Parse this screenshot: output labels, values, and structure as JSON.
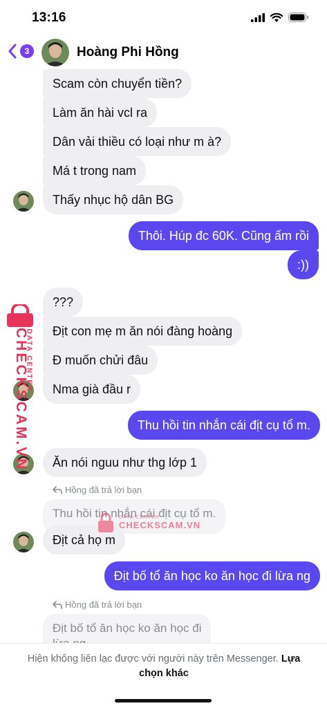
{
  "status_bar": {
    "time": "13:16"
  },
  "header": {
    "back_count": "3",
    "contact_name": "Hoàng Phi Hồng"
  },
  "messages": {
    "m1": "Scam còn chuyển tiền?",
    "m2": "Làm ăn hài vcl ra",
    "m3": "Dân vải thiều có loại như m à?",
    "m4": "Má t trong nam",
    "m5": "Thấy nhục hộ dân BG",
    "o1": "Thôi. Húp đc 60K. Cũng ấm rồi",
    "o2": ":))",
    "m6": "???",
    "m7": "Địt con mẹ m ăn nói đàng hoàng",
    "m8": "Đ muốn chửi đâu",
    "m9": "Nma già đầu r",
    "o3": "Thu hồi tin nhắn cái địt cụ tổ m.",
    "m10": "Ăn nói nguu như thg lớp 1",
    "reply1_label": "Hồng đã trả lời bạn",
    "reply1_quote": "Thu hồi tin nhắn cái địt cụ tổ m.",
    "m11": "Địt cả họ m",
    "o4": "Địt bố tổ ăn học ko ăn học đi lừa ng",
    "reply2_label": "Hồng đã trả lời bạn",
    "reply2_quote_line1": "Địt bố tổ ăn học ko ăn học đi",
    "reply2_quote_line2": "lừa ng"
  },
  "watermark": {
    "vertical_main": "CHECKSCAM.VN",
    "vertical_sub": "DATA CENTER",
    "center_sub": "DATA CENTER",
    "center_main": "CHECKSCAM.VN"
  },
  "footer": {
    "text": "Hiện không liên lạc được với người này trên Messenger.",
    "link": "Lựa chọn khác"
  },
  "colors": {
    "accent": "#7b3ff2",
    "outgoing_bubble": "#5b47f0",
    "incoming_bubble": "#efeff1",
    "watermark": "#e8345a"
  }
}
